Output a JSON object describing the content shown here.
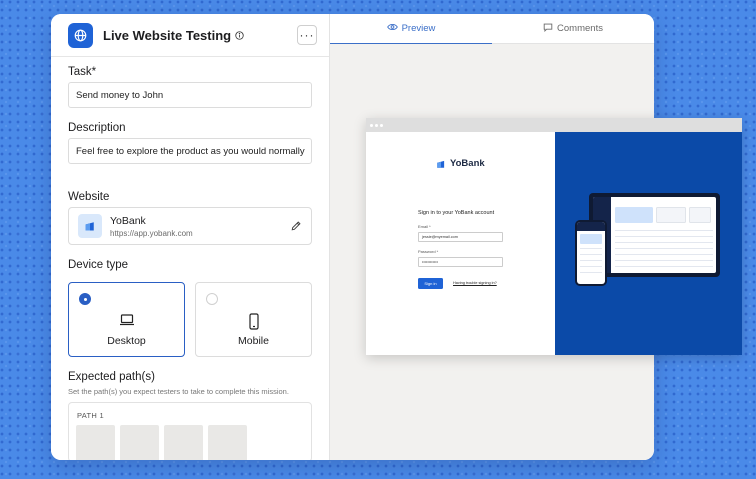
{
  "header": {
    "title": "Live Website Testing",
    "more_label": "···"
  },
  "task": {
    "label": "Task*",
    "value": "Send money to John"
  },
  "description": {
    "label": "Description",
    "value": "Feel free to explore the product as you would normally"
  },
  "website": {
    "label": "Website",
    "name": "YoBank",
    "url": "https://app.yobank.com"
  },
  "device_type": {
    "label": "Device type",
    "options": [
      {
        "label": "Desktop",
        "selected": true
      },
      {
        "label": "Mobile",
        "selected": false
      }
    ]
  },
  "expected_paths": {
    "label": "Expected path(s)",
    "hint": "Set the path(s) you expect testers to take to complete this mission.",
    "path_title": "PATH 1"
  },
  "tabs": [
    {
      "label": "Preview",
      "icon": "eye-icon",
      "active": true
    },
    {
      "label": "Comments",
      "icon": "comment-icon",
      "active": false
    }
  ],
  "preview": {
    "brand": "YoBank",
    "heading": "Sign in to your YoBank account",
    "email_label": "Email *",
    "email_value": "jessie@myemail.com",
    "password_label": "Password *",
    "password_value": "••••••••••••",
    "signin_label": "Sign in",
    "trouble_label": "Having trouble signing in?"
  },
  "colors": {
    "accent": "#1f63d6",
    "selected_border": "#2a5fc4",
    "background": "#4a8ae8",
    "preview_panel": "#0b4aa8"
  }
}
